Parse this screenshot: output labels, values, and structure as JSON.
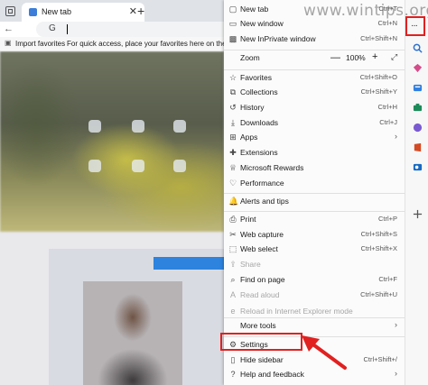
{
  "browser": {
    "tab_title": "New tab",
    "close_glyph": "✕",
    "new_tab_glyph": "+",
    "back_glyph": "←",
    "address_prefix": "G",
    "favbar": {
      "import_label": "Import favorites",
      "hint": "For quick access, place your favorites here on the favorites bar."
    }
  },
  "watermark": "www.wintips.org",
  "menu": {
    "items": [
      {
        "label": "New tab",
        "shortcut": "Ctrl+T",
        "icon": "new-tab-icon",
        "glyph": "▢"
      },
      {
        "label": "New window",
        "shortcut": "Ctrl+N",
        "icon": "new-window-icon",
        "glyph": "▭"
      },
      {
        "label": "New InPrivate window",
        "shortcut": "Ctrl+Shift+N",
        "icon": "inprivate-icon",
        "glyph": "▩"
      },
      {
        "label": "Zoom",
        "icon": "zoom-icon",
        "glyph": "",
        "zoom": {
          "minus": "—",
          "value": "100%",
          "plus": "+",
          "expand": "⤢"
        }
      },
      {
        "label": "Favorites",
        "shortcut": "Ctrl+Shift+O",
        "icon": "favorites-icon",
        "glyph": "☆"
      },
      {
        "label": "Collections",
        "shortcut": "Ctrl+Shift+Y",
        "icon": "collections-icon",
        "glyph": "⧉"
      },
      {
        "label": "History",
        "shortcut": "Ctrl+H",
        "icon": "history-icon",
        "glyph": "↺"
      },
      {
        "label": "Downloads",
        "shortcut": "Ctrl+J",
        "icon": "downloads-icon",
        "glyph": "⤓"
      },
      {
        "label": "Apps",
        "arrow": "›",
        "icon": "apps-icon",
        "glyph": "⊞"
      },
      {
        "label": "Extensions",
        "icon": "extensions-icon",
        "glyph": "✚"
      },
      {
        "label": "Microsoft Rewards",
        "icon": "rewards-icon",
        "glyph": "♕"
      },
      {
        "label": "Performance",
        "icon": "performance-icon",
        "glyph": "♡"
      },
      {
        "label": "Alerts and tips",
        "icon": "alerts-icon",
        "glyph": "🔔"
      },
      {
        "label": "Print",
        "shortcut": "Ctrl+P",
        "icon": "print-icon",
        "glyph": "⎙"
      },
      {
        "label": "Web capture",
        "shortcut": "Ctrl+Shift+S",
        "icon": "web-capture-icon",
        "glyph": "✂"
      },
      {
        "label": "Web select",
        "shortcut": "Ctrl+Shift+X",
        "icon": "web-select-icon",
        "glyph": "⬚"
      },
      {
        "label": "Share",
        "icon": "share-icon",
        "glyph": "⇪",
        "disabled": true
      },
      {
        "label": "Find on page",
        "shortcut": "Ctrl+F",
        "icon": "find-icon",
        "glyph": "⌕"
      },
      {
        "label": "Read aloud",
        "shortcut": "Ctrl+Shift+U",
        "icon": "read-aloud-icon",
        "glyph": "A",
        "disabled": true
      },
      {
        "label": "Reload in Internet Explorer mode",
        "icon": "ie-mode-icon",
        "glyph": "e",
        "disabled": true
      },
      {
        "label": "More tools",
        "arrow": "›",
        "icon": "more-tools-icon",
        "glyph": ""
      },
      {
        "label": "Settings",
        "icon": "settings-icon",
        "glyph": "⚙"
      },
      {
        "label": "Hide sidebar",
        "shortcut": "Ctrl+Shift+/",
        "icon": "hide-sidebar-icon",
        "glyph": "▯"
      },
      {
        "label": "Help and feedback",
        "arrow": "›",
        "icon": "help-icon",
        "glyph": "?"
      }
    ]
  },
  "sidebar": {
    "more_glyph": "···",
    "icons": [
      "search-icon",
      "shopping-icon",
      "collections-sidebar-icon",
      "tools-icon",
      "games-icon",
      "office-icon",
      "outlook-icon",
      "add-icon"
    ]
  },
  "colors": {
    "highlight": "#e12020",
    "menu_bg": "#fbfbfb",
    "accent_blue": "#2d83de"
  }
}
